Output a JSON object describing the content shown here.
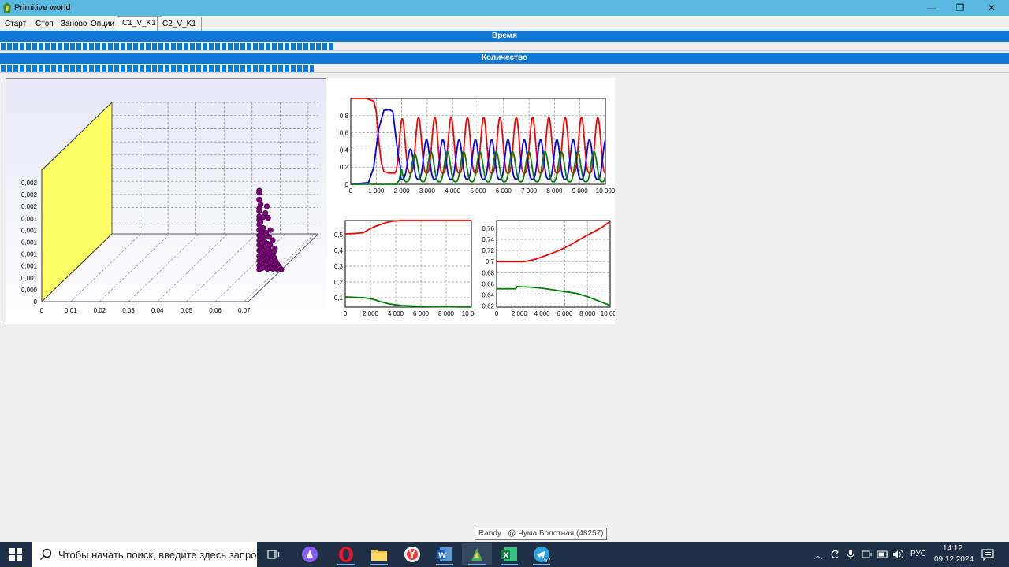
{
  "window": {
    "title": "Primitive world",
    "min_label": "—",
    "max_label": "❐",
    "close_label": "✕"
  },
  "menu": {
    "items": [
      "Старт",
      "Стоп",
      "Заново",
      "Опции"
    ],
    "tabs": [
      "C1_V_K1",
      "C2_V_K1"
    ],
    "active_tab": 0
  },
  "progress": {
    "time_label": "Время",
    "time_fraction": 0.33,
    "count_label": "Количество",
    "count_fraction": 0.31,
    "color": "#0f78d7"
  },
  "chart_data": [
    {
      "type": "scatter",
      "id": "scatter3d",
      "x_ticks": [
        "0",
        "0,01",
        "0,02",
        "0,03",
        "0,04",
        "0,05",
        "0,06",
        "0,07"
      ],
      "y_ticks": [
        "0",
        "0,000",
        "0,001",
        "0,001",
        "0,001",
        "0,001",
        "0,001",
        "0,001",
        "0,002",
        "0,002",
        "0,002"
      ],
      "wall_color": "#ffff66",
      "point_color": "#800080",
      "xlim": [
        0,
        0.07
      ],
      "ylim": [
        0,
        0.0022
      ],
      "points": [
        [
          0.0548,
          0.00118
        ],
        [
          0.0548,
          0.00115
        ],
        [
          0.0548,
          0.00105
        ],
        [
          0.0548,
          0.00092
        ],
        [
          0.0548,
          0.00088
        ],
        [
          0.0548,
          0.0008
        ],
        [
          0.0548,
          0.00075
        ],
        [
          0.0548,
          0.00068
        ],
        [
          0.0548,
          0.0006
        ],
        [
          0.0548,
          0.00052
        ],
        [
          0.0548,
          0.00045
        ],
        [
          0.0548,
          0.00038
        ],
        [
          0.0548,
          0.0003
        ],
        [
          0.0548,
          0.00022
        ],
        [
          0.0548,
          0.00015
        ],
        [
          0.0548,
          8e-05
        ],
        [
          0.0548,
          2e-05
        ],
        [
          0.0553,
          0.00098
        ],
        [
          0.0553,
          0.00072
        ],
        [
          0.0553,
          0.00048
        ],
        [
          0.0553,
          0.00035
        ],
        [
          0.0553,
          0.00018
        ],
        [
          0.0553,
          6e-05
        ],
        [
          0.0558,
          0.00058
        ],
        [
          0.0558,
          0.00041
        ],
        [
          0.0558,
          0.00027
        ],
        [
          0.0558,
          0.00012
        ],
        [
          0.0558,
          4e-05
        ],
        [
          0.0562,
          0.00079
        ],
        [
          0.0562,
          0.00063
        ],
        [
          0.0562,
          0.0005
        ],
        [
          0.0562,
          0.00034
        ],
        [
          0.0562,
          0.0002
        ],
        [
          0.0562,
          9e-05
        ],
        [
          0.0567,
          0.00043
        ],
        [
          0.0567,
          0.00031
        ],
        [
          0.0567,
          0.00017
        ],
        [
          0.0567,
          5e-05
        ],
        [
          0.0572,
          0.00056
        ],
        [
          0.0572,
          0.00036
        ],
        [
          0.0572,
          0.00024
        ],
        [
          0.0572,
          0.00011
        ],
        [
          0.0577,
          0.0004
        ],
        [
          0.0577,
          0.00026
        ],
        [
          0.0577,
          0.00014
        ],
        [
          0.0577,
          3e-05
        ],
        [
          0.0582,
          0.00033
        ],
        [
          0.0582,
          0.00021
        ],
        [
          0.0582,
          0.0001
        ],
        [
          0.0587,
          0.00038
        ],
        [
          0.0587,
          0.00025
        ],
        [
          0.0587,
          0.00013
        ],
        [
          0.0587,
          4e-05
        ],
        [
          0.0592,
          0.00028
        ],
        [
          0.0592,
          0.00016
        ],
        [
          0.0592,
          7e-05
        ],
        [
          0.0597,
          0.00022
        ],
        [
          0.0597,
          0.00011
        ],
        [
          0.0597,
          3e-05
        ],
        [
          0.0602,
          0.00019
        ],
        [
          0.0602,
          9e-05
        ],
        [
          0.0607,
          0.00014
        ],
        [
          0.0607,
          6e-05
        ],
        [
          0.0612,
          0.0001
        ],
        [
          0.0612,
          3e-05
        ],
        [
          0.0617,
          7e-05
        ],
        [
          0.0622,
          4e-05
        ],
        [
          0.0627,
          2e-05
        ],
        [
          0.0575,
          0.00095
        ],
        [
          0.058,
          0.00078
        ],
        [
          0.0588,
          0.0006
        ],
        [
          0.0596,
          0.00045
        ],
        [
          0.0604,
          0.00033
        ],
        [
          0.057,
          0.00085
        ],
        [
          0.0583,
          0.0005
        ],
        [
          0.06,
          0.00028
        ]
      ]
    },
    {
      "type": "line",
      "id": "top",
      "x_ticks": [
        "0",
        "1 000",
        "2 000",
        "3 000",
        "4 000",
        "5 000",
        "6 000",
        "7 000",
        "8 000",
        "9 000",
        "10 000"
      ],
      "y_ticks": [
        "0",
        "0,2",
        "0,4",
        "0,6",
        "0,8"
      ],
      "xlim": [
        0,
        10000
      ],
      "ylim": [
        0,
        1.0
      ],
      "series": [
        {
          "color": "#ff0000",
          "initial": [
            [
              0,
              1.0
            ],
            [
              600,
              1.0
            ],
            [
              900,
              0.97
            ],
            [
              1000,
              0.85
            ],
            [
              1100,
              0.5
            ],
            [
              1200,
              0.25
            ],
            [
              1300,
              0.15
            ],
            [
              1500,
              0.13
            ],
            [
              1700,
              0.13
            ]
          ],
          "osc": {
            "start": 1700,
            "period": 640,
            "min": 0.13,
            "max": 0.78,
            "max_start": 0.75
          }
        },
        {
          "color": "#0000ff",
          "initial": [
            [
              0,
              0.0
            ],
            [
              700,
              0.02
            ],
            [
              900,
              0.2
            ],
            [
              1100,
              0.65
            ],
            [
              1300,
              0.86
            ],
            [
              1500,
              0.87
            ],
            [
              1650,
              0.85
            ],
            [
              1750,
              0.6
            ],
            [
              1850,
              0.35
            ],
            [
              1950,
              0.2
            ]
          ],
          "osc": {
            "start": 1950,
            "period": 640,
            "min": 0.06,
            "max": 0.52,
            "max_start": 0.3,
            "phase": 0.1
          }
        },
        {
          "color": "#008000",
          "initial": [
            [
              0,
              0.0
            ],
            [
              1800,
              0.0
            ],
            [
              1900,
              0.05
            ],
            [
              2000,
              0.18
            ]
          ],
          "osc": {
            "start": 2000,
            "period": 640,
            "min": 0.03,
            "max": 0.38,
            "max_start": 0.3,
            "phase": 0.3
          }
        }
      ]
    },
    {
      "type": "line",
      "id": "bottom-left",
      "x_ticks": [
        "0",
        "2 000",
        "4 000",
        "6 000",
        "8 000",
        "10 000"
      ],
      "y_ticks": [
        "0,1",
        "0,2",
        "0,3",
        "0,4",
        "0,5"
      ],
      "xlim": [
        0,
        10000
      ],
      "ylim": [
        0.04,
        0.59
      ],
      "series": [
        {
          "color": "#ff0000",
          "points": [
            [
              0,
              0.505
            ],
            [
              800,
              0.508
            ],
            [
              1400,
              0.512
            ],
            [
              1800,
              0.53
            ],
            [
              2300,
              0.55
            ],
            [
              2800,
              0.565
            ],
            [
              3300,
              0.578
            ],
            [
              3800,
              0.587
            ],
            [
              4500,
              0.59
            ],
            [
              10000,
              0.59
            ]
          ]
        },
        {
          "color": "#008000",
          "points": [
            [
              0,
              0.105
            ],
            [
              1500,
              0.1
            ],
            [
              2200,
              0.09
            ],
            [
              2800,
              0.075
            ],
            [
              3500,
              0.06
            ],
            [
              4500,
              0.05
            ],
            [
              6000,
              0.045
            ],
            [
              8000,
              0.042
            ],
            [
              10000,
              0.04
            ]
          ]
        }
      ]
    },
    {
      "type": "line",
      "id": "bottom-right",
      "x_ticks": [
        "0",
        "2 000",
        "4 000",
        "6 000",
        "8 000",
        "10 000"
      ],
      "y_ticks": [
        "0,62",
        "0,64",
        "0,66",
        "0,68",
        "0,7",
        "0,72",
        "0,74",
        "0,76"
      ],
      "xlim": [
        0,
        10000
      ],
      "ylim": [
        0.618,
        0.774
      ],
      "series": [
        {
          "color": "#ff0000",
          "points": [
            [
              0,
              0.7
            ],
            [
              2500,
              0.7
            ],
            [
              3500,
              0.705
            ],
            [
              4500,
              0.712
            ],
            [
              5500,
              0.72
            ],
            [
              6500,
              0.73
            ],
            [
              7500,
              0.742
            ],
            [
              8500,
              0.753
            ],
            [
              9300,
              0.762
            ],
            [
              9700,
              0.768
            ],
            [
              10000,
              0.772
            ]
          ]
        },
        {
          "color": "#008000",
          "points": [
            [
              0,
              0.651
            ],
            [
              1700,
              0.651
            ],
            [
              1800,
              0.655
            ],
            [
              3000,
              0.654
            ],
            [
              4000,
              0.652
            ],
            [
              5000,
              0.649
            ],
            [
              6000,
              0.646
            ],
            [
              7000,
              0.643
            ],
            [
              8000,
              0.637
            ],
            [
              9000,
              0.629
            ],
            [
              10000,
              0.621
            ]
          ]
        }
      ]
    }
  ],
  "taskbar": {
    "search_placeholder": "Чтобы начать поиск, введите здесь запрос",
    "language": "РУС",
    "time": "14:12",
    "date": "09.12.2024",
    "telegram_badge": "57",
    "notification_count": "1"
  },
  "tooltip": {
    "text": "Randy   @ Чума Болотная (48257)"
  }
}
